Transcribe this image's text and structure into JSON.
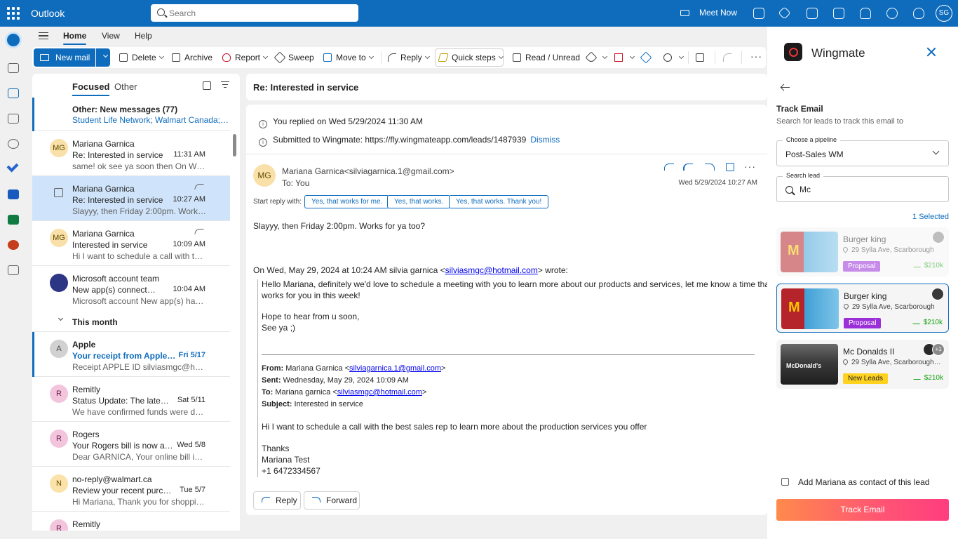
{
  "topbar": {
    "app_name": "Outlook",
    "search_placeholder": "Search",
    "meet_now": "Meet Now",
    "user_initials": "SG"
  },
  "ribbon": {
    "tabs": [
      "Home",
      "View",
      "Help"
    ],
    "new_mail": "New mail",
    "delete": "Delete",
    "archive": "Archive",
    "report": "Report",
    "sweep": "Sweep",
    "move_to": "Move to",
    "reply": "Reply",
    "quick_steps": "Quick steps",
    "read_unread": "Read / Unread"
  },
  "list": {
    "focused": "Focused",
    "other": "Other",
    "other_notice": {
      "title": "Other: New messages (77)",
      "senders": "Student Life Network; Walmart Canada; Mc..."
    },
    "messages": [
      {
        "initials": "MG",
        "sender": "Mariana Garnica",
        "subject": "Re: Interested in service",
        "time": "11:31 AM",
        "preview": "same! ok see ya soon then On Wed, ..."
      },
      {
        "initials": "",
        "sender": "Mariana Garnica",
        "subject": "Re: Interested in service",
        "time": "10:27 AM",
        "preview": "Slayyy, then Friday 2:00pm. Works for..."
      },
      {
        "initials": "MG",
        "sender": "Mariana Garnica",
        "subject": "Interested in service",
        "time": "10:09 AM",
        "preview": "Hi I want to schedule a call with the b..."
      },
      {
        "initials": "",
        "sender": "Microsoft account team",
        "subject": "New app(s) connected to ...",
        "time": "10:04 AM",
        "preview": "Microsoft account New app(s) have a..."
      }
    ],
    "group_label": "This month",
    "older": [
      {
        "initials": "A",
        "sender": "Apple",
        "subject": "Your receipt from Apple / V...",
        "time": "Fri 5/17",
        "preview": "Receipt APPLE ID silviasmgc@hotmai..."
      },
      {
        "initials": "R",
        "sender": "Remitly",
        "subject": "Status Update: The latest o...",
        "time": "Sat 5/11",
        "preview": "We have confirmed funds were depo..."
      },
      {
        "initials": "R",
        "sender": "Rogers",
        "subject": "Your Rogers bill is now avai...",
        "time": "Wed 5/8",
        "preview": "Dear GARNICA, Your online bill is no..."
      },
      {
        "initials": "N",
        "sender": "no-reply@walmart.ca",
        "subject": "Review your recent purchase",
        "time": "Tue 5/7",
        "preview": "Hi Mariana, Thank you for shopping ..."
      },
      {
        "initials": "R",
        "sender": "Remitly",
        "subject": "",
        "time": "",
        "preview": ""
      }
    ]
  },
  "reading": {
    "subject": "Re: Interested in service",
    "replied_info": "You replied on Wed 5/29/2024 11:30 AM",
    "submitted_info": "Submitted to Wingmate: https://fly.wingmateapp.com/leads/1487939",
    "dismiss": "Dismiss",
    "avatar": "MG",
    "from": "Mariana Garnica<silviagarnica.1@gmail.com>",
    "to": "To:  You",
    "date": "Wed 5/29/2024 10:27 AM",
    "start_reply_label": "Start reply with:",
    "suggestions": [
      "Yes, that works for me.",
      "Yes, that works.",
      "Yes, that works. Thank you!"
    ],
    "body_line": "Slayyy, then Friday 2:00pm. Works for ya too?",
    "quote_intro": "On Wed, May 29, 2024 at 10:24 AM silvia garnica <",
    "quote_email": "silviasmgc@hotmail.com",
    "quote_intro_end": "> wrote:",
    "quote_lines": [
      "Hello Mariana, definitely we'd love to schedule a meeting with you to learn more about our products and services, let me know a time that",
      "works for you in this week!",
      "Hope to hear from u soon,",
      "See ya ;)"
    ],
    "hdr_from_label": "From:",
    "hdr_from": " Mariana Garnica <",
    "hdr_from_email": "silviagarnica.1@gmail.com",
    "hdr_sent_label": "Sent:",
    "hdr_sent": " Wednesday, May 29, 2024 10:09 AM",
    "hdr_to_label": "To:",
    "hdr_to": " Mariana garnica <",
    "hdr_to_email": "silviasmgc@hotmail.com",
    "hdr_subject_label": "Subject:",
    "hdr_subject": " Interested in service",
    "orig_lines": [
      "Hi I want to schedule a call with the best sales rep to learn more about the production services you offer",
      "Thanks",
      "Mariana Test",
      "+1 6472334567"
    ],
    "reply_btn": "Reply",
    "forward_btn": "Forward"
  },
  "wingmate": {
    "title": "Wingmate",
    "heading": "Track Email",
    "subheading": "Search for leads to track this email to",
    "pipeline_label": "Choose a pipeline",
    "pipeline_value": "Post-Sales WM",
    "search_label": "Search lead",
    "search_value": "Mc",
    "selected_count": "1 Selected",
    "leads": [
      {
        "name": "Burger king",
        "address": "29 Sylla Ave, Scarborough",
        "stage": "Proposal",
        "amount": "$210k"
      },
      {
        "name": "Burger king",
        "address": "29 Sylla Ave, Scarborough",
        "stage": "Proposal",
        "amount": "$210k"
      },
      {
        "name": "Mc Donalds II",
        "address": "29 Sylla Ave, Scarborough ....",
        "stage": "New Leads",
        "amount": "$210k",
        "extra": "+1"
      }
    ],
    "add_contact": "Add Mariana as contact of this lead",
    "track_button": "Track Email"
  }
}
